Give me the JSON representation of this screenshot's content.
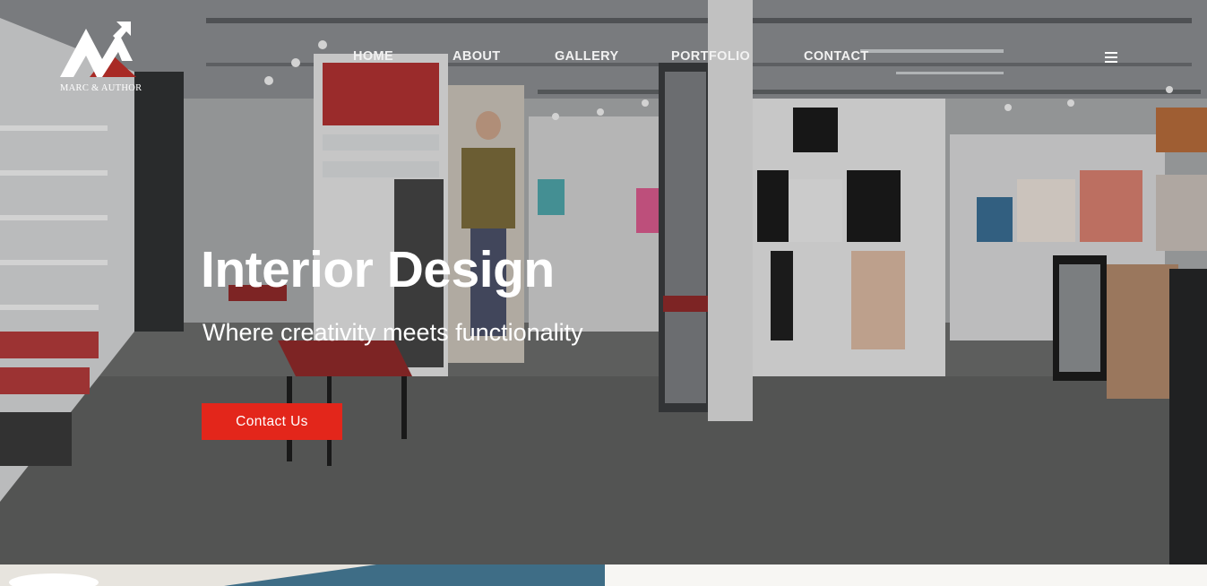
{
  "brand": {
    "name": "MARC & AUTHOR",
    "accent": "#e3261b",
    "logo_red": "#c8302a"
  },
  "nav": {
    "items": [
      {
        "label": "HOME"
      },
      {
        "label": "ABOUT"
      },
      {
        "label": "GALLERY"
      },
      {
        "label": "PORTFOLIO"
      },
      {
        "label": "CONTACT"
      }
    ],
    "menu_icon": "hamburger-menu-icon"
  },
  "hero": {
    "title": "Interior Design",
    "subtitle": "Where creativity meets functionality",
    "cta_label": "Contact Us",
    "background_image": "retail store interior photo"
  }
}
